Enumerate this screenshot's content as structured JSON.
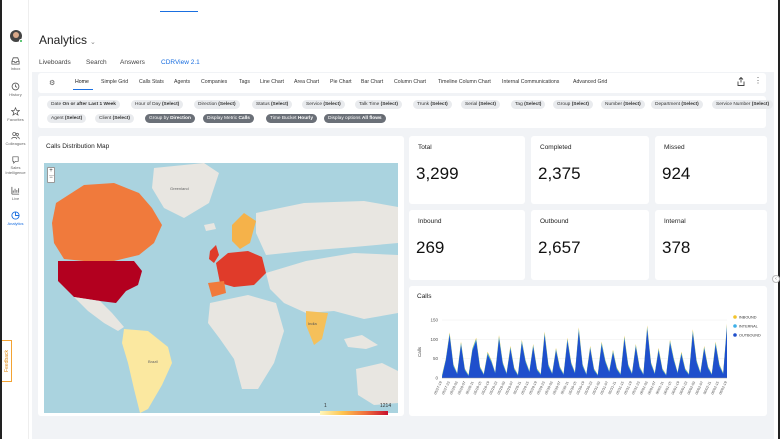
{
  "rail": {
    "items": [
      {
        "label": "Inbox",
        "icon": "inbox-icon"
      },
      {
        "label": "History",
        "icon": "history-icon"
      },
      {
        "label": "Favorites",
        "icon": "star-icon"
      },
      {
        "label": "Colleagues",
        "icon": "people-icon"
      },
      {
        "label": "Sales Intelligence",
        "icon": "sales-intelligence-icon"
      },
      {
        "label": "Live",
        "icon": "live-icon"
      },
      {
        "label": "Analytics",
        "icon": "analytics-icon"
      }
    ],
    "feedback": "Feedback"
  },
  "header": {
    "title": "Analytics"
  },
  "toptabs": [
    "Liveboards",
    "Search",
    "Answers",
    "CDRView 2.1"
  ],
  "subtabs": [
    "Home",
    "Simple Grid",
    "Calls Stats",
    "Agents",
    "Companies",
    "Tags",
    "Line Chart",
    "Area Chart",
    "Pie Chart",
    "Bar Chart",
    "Column Chart",
    "Timeline Column Chart",
    "Internal Communications",
    "Advanced Grid"
  ],
  "filters": {
    "row1": [
      {
        "label": "Date",
        "value": "On or after Last 1 Week"
      },
      {
        "label": "Hour of Day",
        "value": "(Select)"
      },
      {
        "label": "Direction",
        "value": "(Select)"
      },
      {
        "label": "Status",
        "value": "(Select)"
      },
      {
        "label": "Service",
        "value": "(Select)"
      },
      {
        "label": "Talk Time",
        "value": "(Select)"
      },
      {
        "label": "Trunk",
        "value": "(Select)"
      },
      {
        "label": "Serial",
        "value": "(Select)"
      },
      {
        "label": "Tag",
        "value": "(Select)"
      },
      {
        "label": "Group",
        "value": "(Select)"
      },
      {
        "label": "Number",
        "value": "(Select)"
      },
      {
        "label": "Department",
        "value": "(Select)"
      },
      {
        "label": "Service Number",
        "value": "(Select)"
      }
    ],
    "row2": [
      {
        "label": "Agent",
        "value": "(Select)"
      },
      {
        "label": "Client",
        "value": "(Select)"
      },
      {
        "label": "Group by",
        "value": "Direction"
      },
      {
        "label": "Display Metric",
        "value": "Calls"
      },
      {
        "label": "Time Bucket",
        "value": "Hourly"
      },
      {
        "label": "Display options",
        "value": "All flows"
      }
    ]
  },
  "map": {
    "title": "Calls Distribution Map",
    "zoom_in": "+",
    "zoom_out": "−",
    "legend_min": "1",
    "legend_max": "1214",
    "labels": {
      "greenland": "Greenland",
      "brazil": "Brazil",
      "india": "India"
    },
    "colors": {
      "water": "#aad3df",
      "land": "#e8e6e1",
      "usa": "#b3001f",
      "canada": "#f07a3c",
      "europe": "#e03b2a",
      "south_america": "#fbe8a0",
      "australia": "#f7d26b"
    }
  },
  "stats": [
    {
      "label": "Total",
      "value": "3,299"
    },
    {
      "label": "Completed",
      "value": "2,375"
    },
    {
      "label": "Missed",
      "value": "924"
    },
    {
      "label": "Inbound",
      "value": "269"
    },
    {
      "label": "Outbound",
      "value": "2,657"
    },
    {
      "label": "Internal",
      "value": "378"
    }
  ],
  "chart_data": {
    "type": "area",
    "title": "Calls",
    "ylabel": "Calls",
    "ylim": [
      0,
      150
    ],
    "yticks": [
      0,
      50,
      100,
      150
    ],
    "series": [
      {
        "name": "INBOUND",
        "color": "#f2c32c"
      },
      {
        "name": "INTERNAL",
        "color": "#3fb0e8"
      },
      {
        "name": "OUTBOUND",
        "color": "#1f4fcc"
      }
    ],
    "values": [
      [
        2,
        4,
        2
      ],
      [
        1,
        3,
        45
      ],
      [
        3,
        5,
        110
      ],
      [
        2,
        4,
        30
      ],
      [
        1,
        2,
        10
      ],
      [
        3,
        6,
        85
      ],
      [
        2,
        3,
        20
      ],
      [
        1,
        2,
        5
      ],
      [
        2,
        5,
        70
      ],
      [
        3,
        6,
        95
      ],
      [
        2,
        3,
        25
      ],
      [
        1,
        2,
        8
      ],
      [
        3,
        5,
        60
      ],
      [
        2,
        4,
        40
      ],
      [
        1,
        2,
        12
      ],
      [
        4,
        7,
        100
      ],
      [
        2,
        4,
        35
      ],
      [
        1,
        2,
        10
      ],
      [
        3,
        5,
        75
      ],
      [
        2,
        3,
        22
      ],
      [
        1,
        2,
        6
      ],
      [
        3,
        6,
        90
      ],
      [
        2,
        4,
        40
      ],
      [
        1,
        2,
        15
      ],
      [
        3,
        5,
        80
      ],
      [
        2,
        3,
        20
      ],
      [
        1,
        2,
        8
      ],
      [
        4,
        6,
        110
      ],
      [
        2,
        4,
        30
      ],
      [
        1,
        2,
        10
      ],
      [
        3,
        5,
        70
      ],
      [
        2,
        3,
        25
      ],
      [
        1,
        2,
        8
      ],
      [
        3,
        6,
        95
      ],
      [
        2,
        4,
        35
      ],
      [
        1,
        2,
        12
      ],
      [
        4,
        7,
        120
      ],
      [
        2,
        4,
        30
      ],
      [
        1,
        2,
        8
      ],
      [
        3,
        5,
        75
      ],
      [
        2,
        3,
        20
      ],
      [
        1,
        2,
        6
      ],
      [
        3,
        6,
        85
      ],
      [
        2,
        4,
        40
      ],
      [
        1,
        2,
        15
      ],
      [
        3,
        5,
        65
      ],
      [
        2,
        3,
        22
      ],
      [
        1,
        2,
        8
      ],
      [
        4,
        6,
        100
      ],
      [
        2,
        4,
        30
      ],
      [
        1,
        2,
        10
      ],
      [
        3,
        5,
        80
      ],
      [
        2,
        3,
        25
      ],
      [
        1,
        2,
        8
      ],
      [
        4,
        7,
        125
      ],
      [
        2,
        4,
        35
      ],
      [
        1,
        2,
        10
      ],
      [
        3,
        5,
        70
      ],
      [
        2,
        3,
        20
      ],
      [
        1,
        2,
        6
      ],
      [
        3,
        6,
        90
      ],
      [
        2,
        4,
        45
      ],
      [
        1,
        2,
        12
      ],
      [
        3,
        5,
        60
      ],
      [
        2,
        3,
        20
      ],
      [
        1,
        2,
        8
      ],
      [
        4,
        7,
        115
      ],
      [
        2,
        4,
        40
      ],
      [
        1,
        2,
        12
      ],
      [
        3,
        5,
        75
      ],
      [
        2,
        3,
        25
      ],
      [
        1,
        2,
        8
      ],
      [
        3,
        6,
        85
      ],
      [
        2,
        4,
        30
      ],
      [
        1,
        2,
        10
      ],
      [
        4,
        7,
        130
      ]
    ],
    "x_tick_labels": [
      "05/27-19",
      "05/27-23",
      "05/28-03",
      "05/28-07",
      "05/28-11",
      "05/28-15",
      "05/28-19",
      "05/28-23",
      "05/29-03",
      "05/29-07",
      "05/29-11",
      "05/29-15",
      "05/29-19",
      "05/29-23",
      "05/30-03",
      "05/30-07",
      "05/30-11",
      "05/30-15",
      "05/30-19",
      "05/30-23",
      "05/31-03",
      "05/31-07",
      "05/31-11",
      "05/31-15",
      "05/31-19",
      "05/31-23",
      "06/01-03",
      "06/01-07",
      "06/01-11",
      "06/01-15",
      "06/01-19",
      "06/01-23",
      "06/02-03",
      "06/02-07",
      "06/02-11",
      "06/02-15",
      "06/02-19"
    ]
  }
}
